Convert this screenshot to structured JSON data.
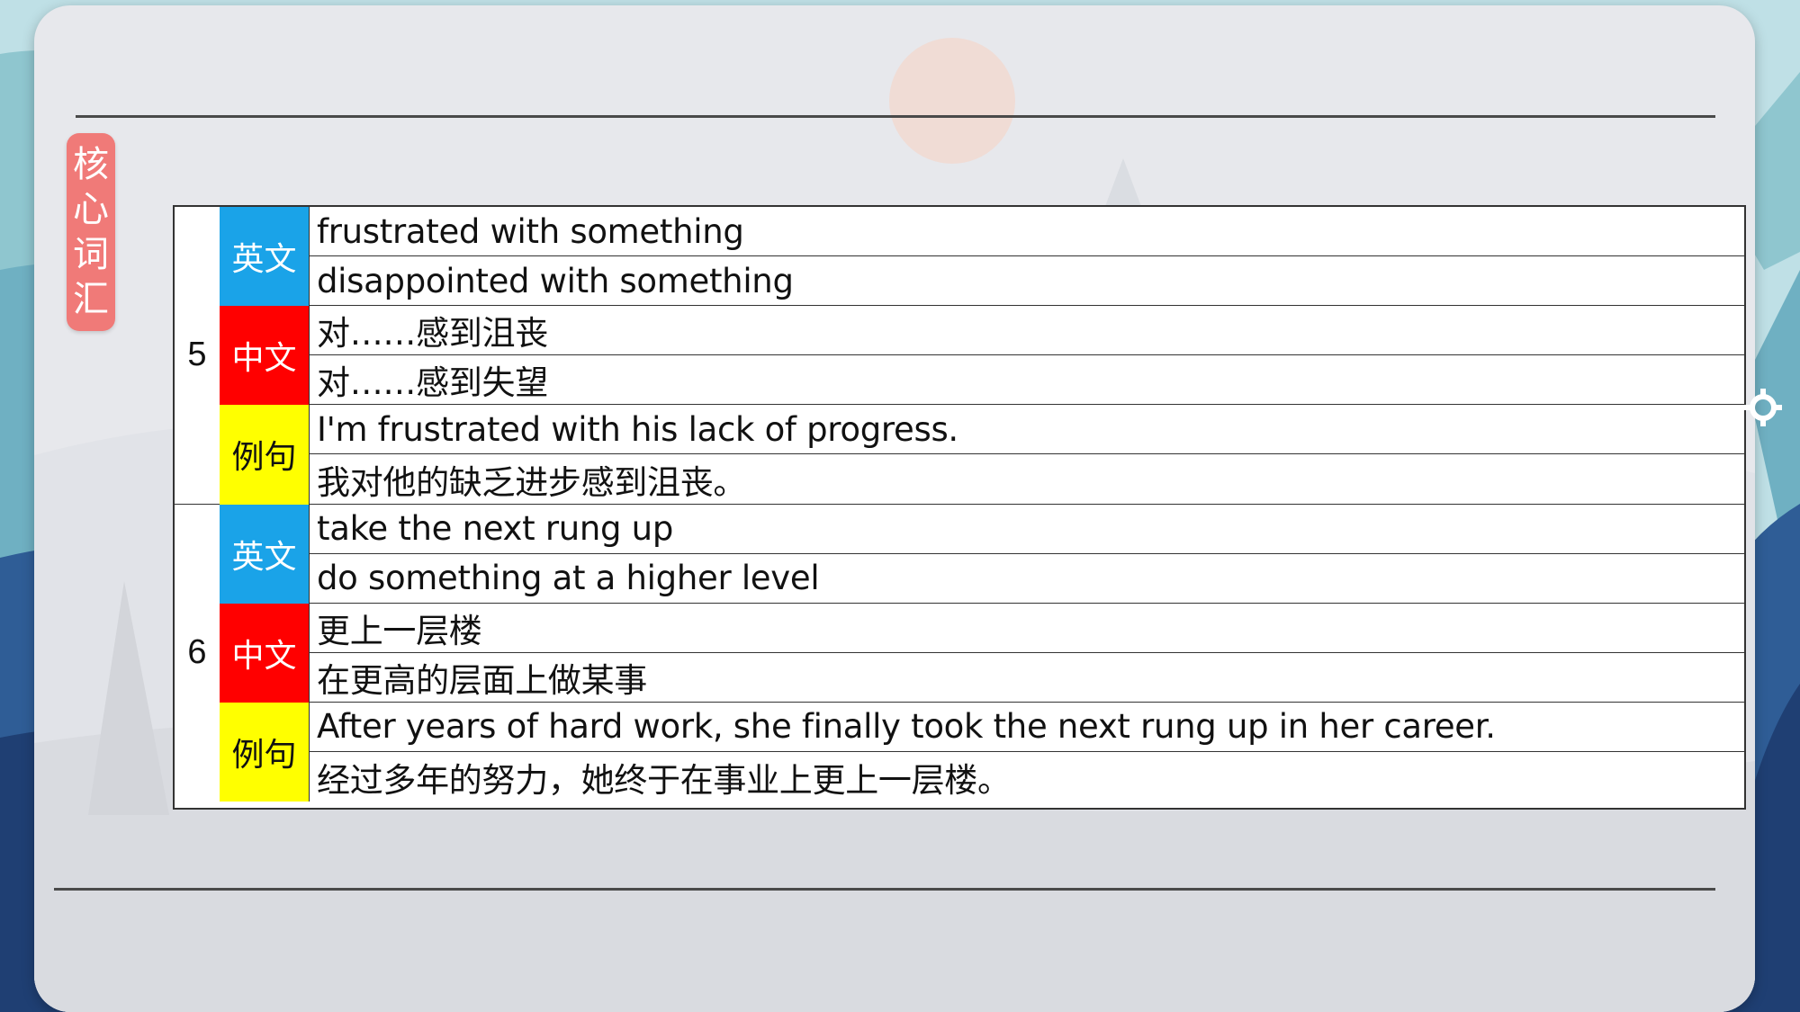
{
  "side_tag": [
    "核",
    "心",
    "词",
    "汇"
  ],
  "labels": {
    "english": "英文",
    "chinese": "中文",
    "example": "例句"
  },
  "entries": [
    {
      "number": "5",
      "english": [
        "frustrated with something",
        "disappointed with something"
      ],
      "chinese": [
        "对……感到沮丧",
        "对……感到失望"
      ],
      "example": [
        "I'm frustrated with his lack of progress.",
        "我对他的缺乏进步感到沮丧。"
      ]
    },
    {
      "number": "6",
      "english": [
        "take the next rung up",
        "do something at a higher level"
      ],
      "chinese": [
        "更上一层楼",
        "在更高的层面上做某事"
      ],
      "example": [
        "After years of hard work, she finally took the next rung up in her career.",
        "经过多年的努力，她终于在事业上更上一层楼。"
      ]
    }
  ],
  "colors": {
    "english_label_bg": "#1aa3e8",
    "chinese_label_bg": "#ff0000",
    "example_label_bg": "#ffff00",
    "side_tag_bg": "#f07a78"
  }
}
